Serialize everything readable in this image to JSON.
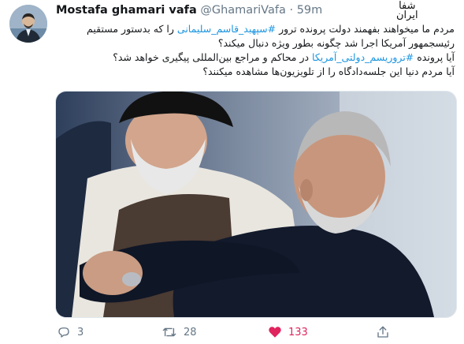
{
  "author": {
    "name": "Mostafa ghamari vafa",
    "handle": "@GhamariVafa",
    "separator": "·",
    "time": "59m"
  },
  "watermark": {
    "line1": "شفا",
    "line2": "ایران"
  },
  "tweet": {
    "line1_before": "مردم ما میخواهند بفهمند دولت پرونده ترور ",
    "line1_link": "#سپهبد_قاسم_سلیمانی",
    "line1_after": " را که بدستور مستقیم",
    "line2": "رئیسجمهور آمریکا اجرا شد چگونه بطور ویژه دنبال میکند؟",
    "line3_before": "آیا پرونده ",
    "line3_link": "#تروریسم_دولتی_آمریکا",
    "line3_after": " در محاکم و مراجع بین‌المللی پیگیری خواهد شد؟",
    "line4": "آیا مردم دنیا این جلسه‌دادگاه را از تلویزیون‌ها مشاهده میکنند؟"
  },
  "actions": {
    "replies": "3",
    "retweets": "28",
    "likes": "133"
  },
  "colors": {
    "link": "#1b95e0",
    "like": "#e0245e",
    "muted": "#657786"
  }
}
